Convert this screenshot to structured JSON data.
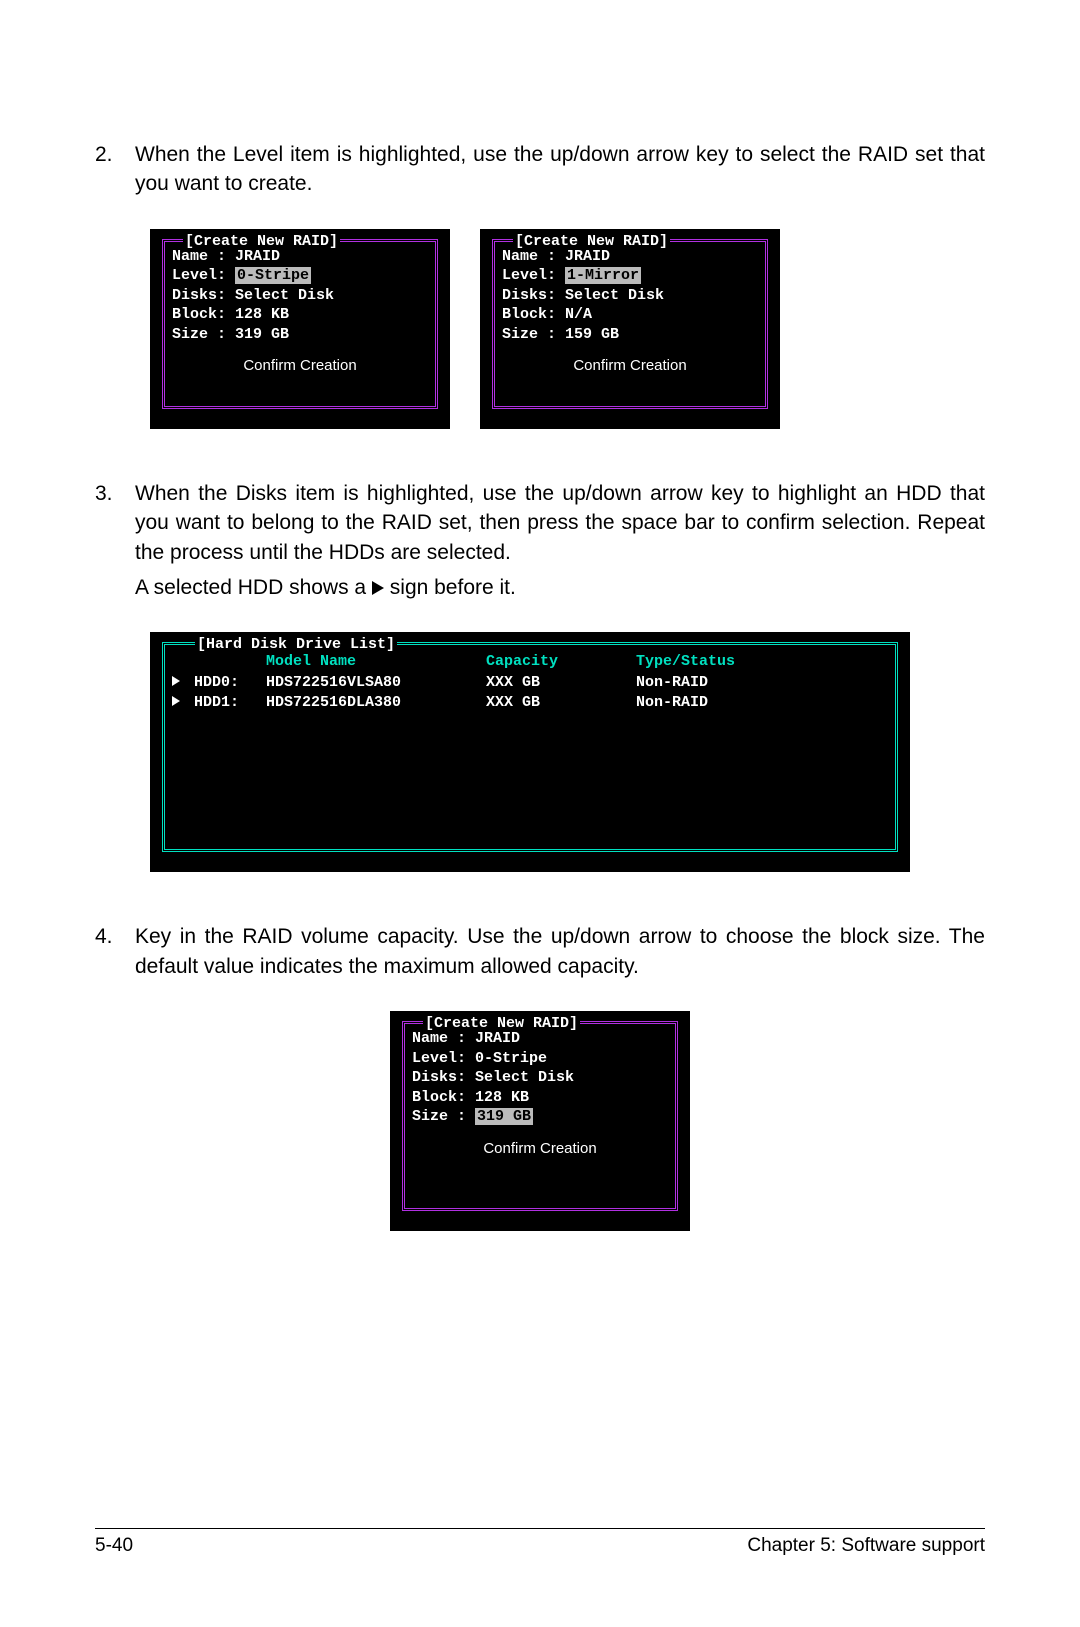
{
  "steps": {
    "s2": {
      "num": "2.",
      "text": "When the Level item is highlighted, use the up/down arrow key to select the RAID set that you want to create."
    },
    "s3": {
      "num": "3.",
      "text": "When the Disks item is highlighted, use the up/down arrow key to highlight an HDD that you want to belong to the RAID set, then press the space bar to confirm selection. Repeat the process until the HDDs are selected.",
      "extra_pre": "A selected HDD shows a ",
      "extra_post": " sign before it."
    },
    "s4": {
      "num": "4.",
      "text": "Key in the RAID volume capacity. Use the up/down arrow to choose the block size. The default value indicates the maximum allowed capacity."
    }
  },
  "panel_title": "[Create New RAID]",
  "labels": {
    "name": "Name : ",
    "level": "Level: ",
    "disks": "Disks: ",
    "block": "Block: ",
    "size": "Size : ",
    "confirm": "Confirm Creation"
  },
  "panel1": {
    "name": "JRAID",
    "level": "0-Stripe",
    "disks": "Select Disk",
    "block": "128 KB",
    "size": "319 GB"
  },
  "panel2": {
    "name": "JRAID",
    "level": "1-Mirror",
    "disks": "Select Disk",
    "block": "N/A",
    "size": "159 GB"
  },
  "panel3": {
    "name": "JRAID",
    "level": "0-Stripe",
    "disks": "Select Disk",
    "block": "128 KB",
    "size": "319 GB"
  },
  "hdd": {
    "title": "[Hard Disk Drive List]",
    "headers": {
      "model": "Model Name",
      "capacity": "Capacity",
      "type": "Type/Status"
    },
    "rows": [
      {
        "id": "HDD0:",
        "model": "HDS722516VLSA80",
        "capacity": "XXX GB",
        "type": "Non-RAID"
      },
      {
        "id": "HDD1:",
        "model": "HDS722516DLA380",
        "capacity": "XXX GB",
        "type": "Non-RAID"
      }
    ]
  },
  "footer": {
    "page": "5-40",
    "chapter": "Chapter 5: Software support"
  }
}
